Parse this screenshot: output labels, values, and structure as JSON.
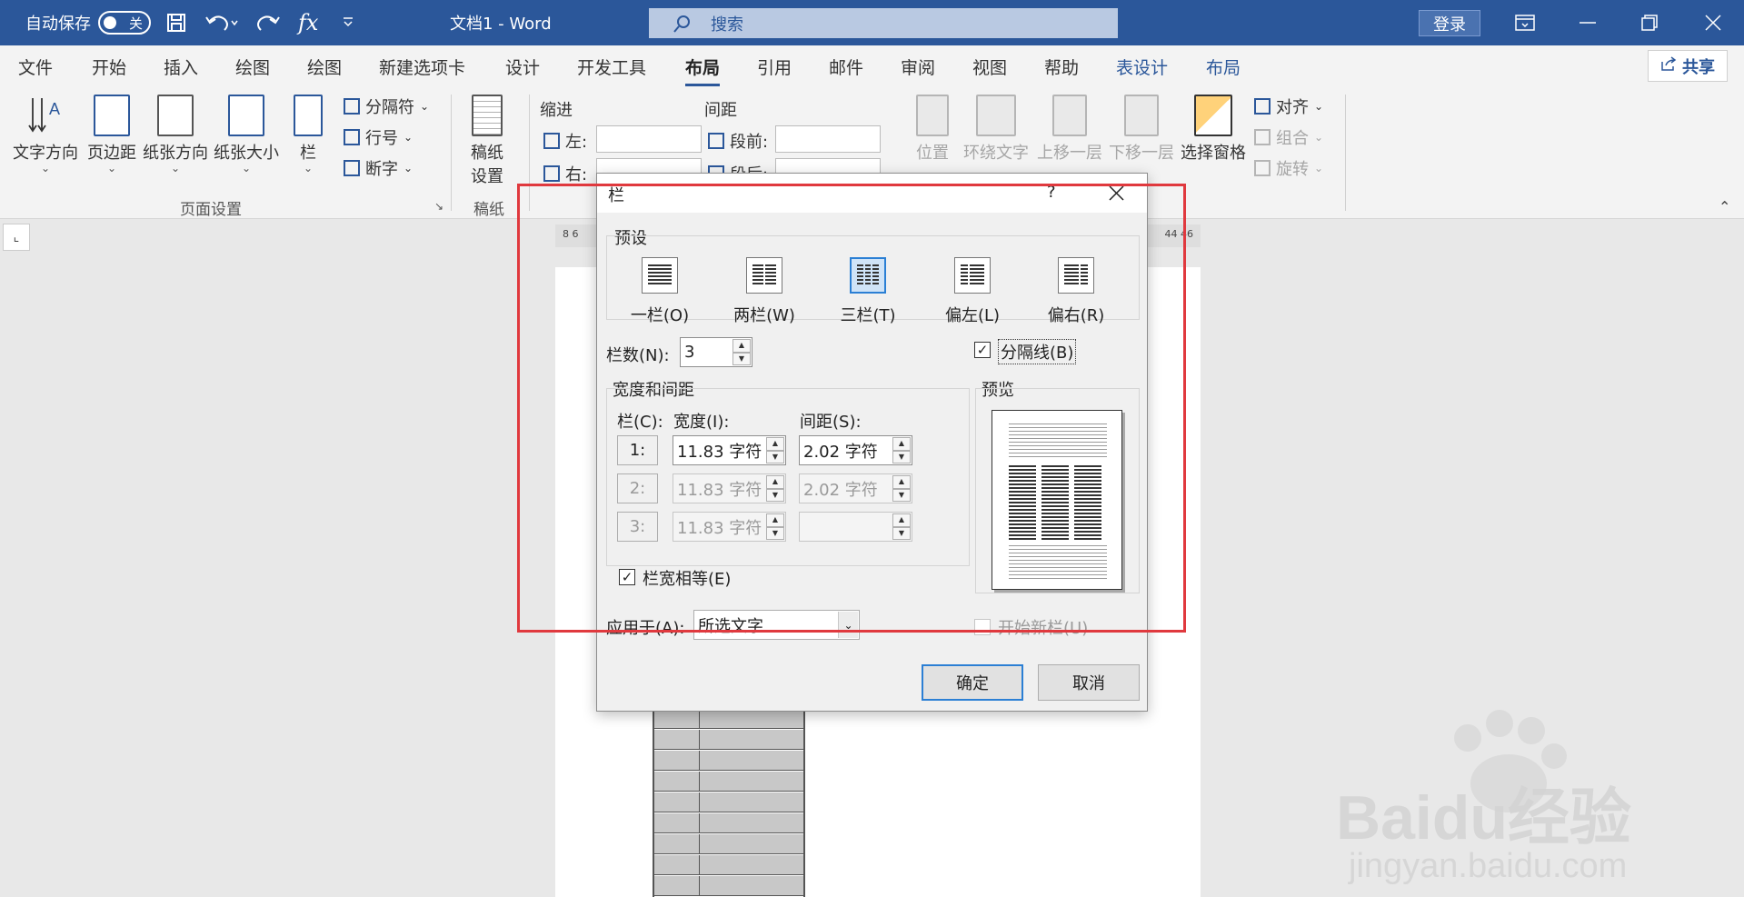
{
  "titlebar": {
    "autosave_label": "自动保存",
    "autosave_state": "关",
    "doc_title": "文档1  -  Word",
    "search_placeholder": "搜索",
    "login_label": "登录",
    "formula_glyph": "fx"
  },
  "tabs": [
    {
      "label": "文件"
    },
    {
      "label": "开始"
    },
    {
      "label": "插入"
    },
    {
      "label": "绘图"
    },
    {
      "label": "绘图"
    },
    {
      "label": "新建选项卡"
    },
    {
      "label": "设计"
    },
    {
      "label": "开发工具"
    },
    {
      "label": "布局"
    },
    {
      "label": "引用"
    },
    {
      "label": "邮件"
    },
    {
      "label": "审阅"
    },
    {
      "label": "视图"
    },
    {
      "label": "帮助"
    },
    {
      "label": "表设计"
    },
    {
      "label": "布局"
    }
  ],
  "share_label": "共享",
  "ribbon": {
    "page_setup": {
      "text_direction": "文字方向",
      "margins": "页边距",
      "orientation": "纸张方向",
      "size": "纸张大小",
      "columns": "栏",
      "breaks": "分隔符",
      "line_numbers": "行号",
      "hyphenation": "断字",
      "group_label": "页面设置"
    },
    "manuscript": {
      "button_line1": "稿纸",
      "button_line2": "设置",
      "group_label": "稿纸"
    },
    "paragraph": {
      "indent_label": "缩进",
      "spacing_label": "间距",
      "left_label": "左:",
      "right_label": "右:",
      "before_label": "段前:",
      "after_label": "段后:"
    },
    "arrange": {
      "position": "位置",
      "wrap_text": "环绕文字",
      "bring_forward": "上移一层",
      "send_backward": "下移一层",
      "selection_pane": "选择窗格",
      "align": "对齐",
      "group": "组合",
      "rotate": "旋转"
    }
  },
  "ruler": {
    "left_ticks": "8   6",
    "right_ticks": "44  46"
  },
  "dialog": {
    "title": "栏",
    "help": "?",
    "presets_label": "预设",
    "presets": [
      {
        "label": "一栏(O)",
        "cols": 1
      },
      {
        "label": "两栏(W)",
        "cols": 2
      },
      {
        "label": "三栏(T)",
        "cols": 3
      },
      {
        "label": "偏左(L)",
        "cols": 2
      },
      {
        "label": "偏右(R)",
        "cols": 2
      }
    ],
    "selected_preset": "三栏(T)",
    "num_columns_label": "栏数(N):",
    "num_columns_value": "3",
    "line_between_label": "分隔线(B)",
    "line_between_checked": true,
    "width_spacing_label": "宽度和间距",
    "col_header": "栏(C):",
    "width_header": "宽度(I):",
    "spacing_header": "间距(S):",
    "rows": [
      {
        "num": "1:",
        "width": "11.83 字符",
        "spacing": "2.02 字符",
        "enabled": true
      },
      {
        "num": "2:",
        "width": "11.83 字符",
        "spacing": "2.02 字符",
        "enabled": false
      },
      {
        "num": "3:",
        "width": "11.83 字符",
        "spacing": "",
        "enabled": false
      }
    ],
    "equal_width_label": "栏宽相等(E)",
    "equal_width_checked": true,
    "preview_label": "预览",
    "apply_to_label": "应用于(A):",
    "apply_to_value": "所选文字",
    "start_new_col_label": "开始新栏(U)",
    "ok_label": "确定",
    "cancel_label": "取消"
  },
  "watermark": {
    "brand": "Baidu经验",
    "url": "jingyan.baidu.com"
  },
  "colors": {
    "word_blue": "#2b579a",
    "highlight_red": "#e0393e",
    "select_blue": "#2b7fd4"
  }
}
